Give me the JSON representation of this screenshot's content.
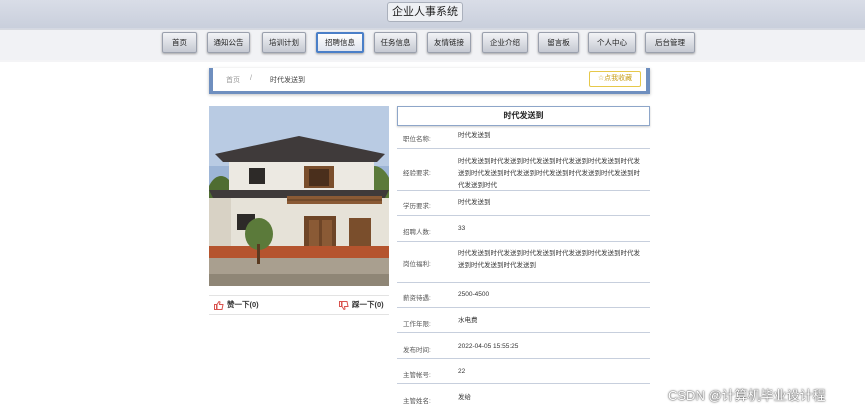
{
  "site": {
    "title": "企业人事系统"
  },
  "nav": [
    "首页",
    "通知公告",
    "培训计划",
    "招聘信息",
    "任务信息",
    "友情链接",
    "企业介绍",
    "留言板",
    "个人中心",
    "后台管理"
  ],
  "breadcrumb": {
    "home": "首页",
    "separator": "/",
    "current": "时代发送到"
  },
  "favorite_label": "☆点我收藏",
  "votes": {
    "up": "赞一下(0)",
    "down": "踩一下(0)"
  },
  "detail": {
    "title": "时代发送到",
    "fields": [
      {
        "label": "职位名称:",
        "value": "时代发送到"
      },
      {
        "label": "经验要求:",
        "value": "时代发送到时代发送到时代发送到时代发送到时代发送到时代发送到时代发送到时代发送到时代发送到时代发送到时代发送到时代发送到时代"
      },
      {
        "label": "学历要求:",
        "value": "时代发送到"
      },
      {
        "label": "招聘人数:",
        "value": "33"
      },
      {
        "label": "岗位福利:",
        "value": "时代发送到时代发送到时代发送到时代发送到时代发送到时代发送到时代发送到时代发送到"
      },
      {
        "label": "薪资待遇:",
        "value": "2500-4500"
      },
      {
        "label": "工作年限:",
        "value": "水电费"
      },
      {
        "label": "发布时间:",
        "value": "2022-04-05 15:55:25"
      },
      {
        "label": "主管帐号:",
        "value": "22"
      },
      {
        "label": "主管姓名:",
        "value": "发给"
      }
    ]
  },
  "watermark": "CSDN @计算机毕业设计程"
}
